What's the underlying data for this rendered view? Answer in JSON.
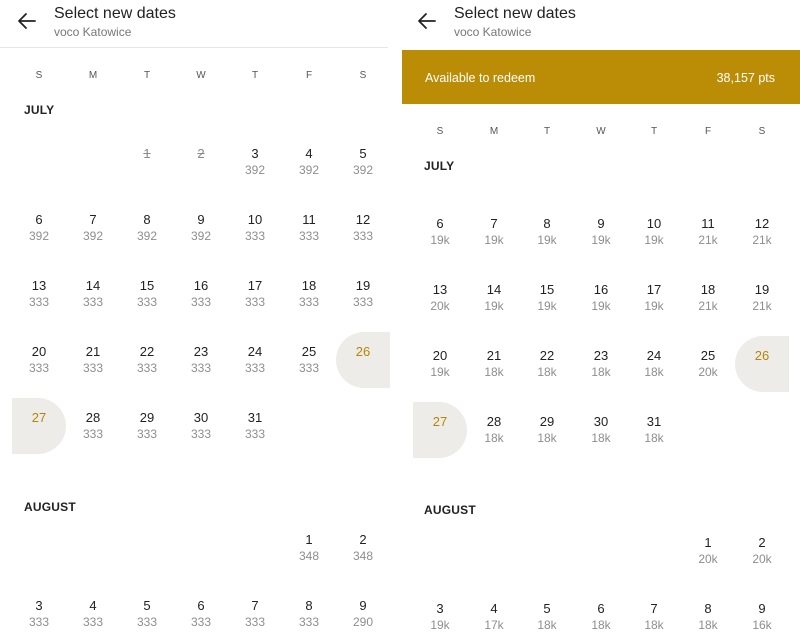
{
  "left": {
    "header": {
      "title": "Select new dates",
      "subtitle": "voco Katowice"
    },
    "weekdays": [
      "S",
      "M",
      "T",
      "W",
      "T",
      "F",
      "S"
    ],
    "july": {
      "label": "JULY",
      "weeks": [
        [
          null,
          null,
          {
            "d": "1",
            "p": "",
            "disabled": true
          },
          {
            "d": "2",
            "p": "",
            "disabled": true
          },
          {
            "d": "3",
            "p": "392"
          },
          {
            "d": "4",
            "p": "392"
          },
          {
            "d": "5",
            "p": "392"
          }
        ],
        [
          {
            "d": "6",
            "p": "392"
          },
          {
            "d": "7",
            "p": "392"
          },
          {
            "d": "8",
            "p": "392"
          },
          {
            "d": "9",
            "p": "392"
          },
          {
            "d": "10",
            "p": "333"
          },
          {
            "d": "11",
            "p": "333"
          },
          {
            "d": "12",
            "p": "333"
          }
        ],
        [
          {
            "d": "13",
            "p": "333"
          },
          {
            "d": "14",
            "p": "333"
          },
          {
            "d": "15",
            "p": "333"
          },
          {
            "d": "16",
            "p": "333"
          },
          {
            "d": "17",
            "p": "333"
          },
          {
            "d": "18",
            "p": "333"
          },
          {
            "d": "19",
            "p": "333"
          }
        ],
        [
          {
            "d": "20",
            "p": "333"
          },
          {
            "d": "21",
            "p": "333"
          },
          {
            "d": "22",
            "p": "333"
          },
          {
            "d": "23",
            "p": "333"
          },
          {
            "d": "24",
            "p": "333"
          },
          {
            "d": "25",
            "p": "333"
          },
          {
            "d": "26",
            "p": "",
            "selected": "start"
          }
        ],
        [
          {
            "d": "27",
            "p": "",
            "selected": "end"
          },
          {
            "d": "28",
            "p": "333"
          },
          {
            "d": "29",
            "p": "333"
          },
          {
            "d": "30",
            "p": "333"
          },
          {
            "d": "31",
            "p": "333"
          },
          null,
          null
        ]
      ]
    },
    "august": {
      "label": "AUGUST",
      "weeks": [
        [
          null,
          null,
          null,
          null,
          null,
          {
            "d": "1",
            "p": "348"
          },
          {
            "d": "2",
            "p": "348"
          }
        ],
        [
          {
            "d": "3",
            "p": "333"
          },
          {
            "d": "4",
            "p": "333"
          },
          {
            "d": "5",
            "p": "333"
          },
          {
            "d": "6",
            "p": "333"
          },
          {
            "d": "7",
            "p": "333"
          },
          {
            "d": "8",
            "p": "333"
          },
          {
            "d": "9",
            "p": "290"
          }
        ]
      ]
    }
  },
  "right": {
    "header": {
      "title": "Select new dates",
      "subtitle": "voco Katowice"
    },
    "banner": {
      "label": "Available to redeem",
      "value": "38,157 pts"
    },
    "weekdays": [
      "S",
      "M",
      "T",
      "W",
      "T",
      "F",
      "S"
    ],
    "july": {
      "label": "JULY",
      "weeks": [
        [
          {
            "d": "6",
            "p": "19k"
          },
          {
            "d": "7",
            "p": "19k"
          },
          {
            "d": "8",
            "p": "19k"
          },
          {
            "d": "9",
            "p": "19k"
          },
          {
            "d": "10",
            "p": "19k"
          },
          {
            "d": "11",
            "p": "21k"
          },
          {
            "d": "12",
            "p": "21k"
          }
        ],
        [
          {
            "d": "13",
            "p": "20k"
          },
          {
            "d": "14",
            "p": "19k"
          },
          {
            "d": "15",
            "p": "19k"
          },
          {
            "d": "16",
            "p": "19k"
          },
          {
            "d": "17",
            "p": "19k"
          },
          {
            "d": "18",
            "p": "21k"
          },
          {
            "d": "19",
            "p": "21k"
          }
        ],
        [
          {
            "d": "20",
            "p": "19k"
          },
          {
            "d": "21",
            "p": "18k"
          },
          {
            "d": "22",
            "p": "18k"
          },
          {
            "d": "23",
            "p": "18k"
          },
          {
            "d": "24",
            "p": "18k"
          },
          {
            "d": "25",
            "p": "20k"
          },
          {
            "d": "26",
            "p": "",
            "selected": "start"
          }
        ],
        [
          {
            "d": "27",
            "p": "",
            "selected": "end"
          },
          {
            "d": "28",
            "p": "18k"
          },
          {
            "d": "29",
            "p": "18k"
          },
          {
            "d": "30",
            "p": "18k"
          },
          {
            "d": "31",
            "p": "18k"
          },
          null,
          null
        ]
      ]
    },
    "august": {
      "label": "AUGUST",
      "weeks": [
        [
          null,
          null,
          null,
          null,
          null,
          {
            "d": "1",
            "p": "20k"
          },
          {
            "d": "2",
            "p": "20k"
          }
        ],
        [
          {
            "d": "3",
            "p": "19k"
          },
          {
            "d": "4",
            "p": "17k"
          },
          {
            "d": "5",
            "p": "18k"
          },
          {
            "d": "6",
            "p": "18k"
          },
          {
            "d": "7",
            "p": "18k"
          },
          {
            "d": "8",
            "p": "18k"
          },
          {
            "d": "9",
            "p": "16k"
          }
        ]
      ]
    },
    "colors": {
      "banner": "#bb8c05",
      "selected_text": "#b38607",
      "selected_bg": "#eeece8"
    }
  }
}
